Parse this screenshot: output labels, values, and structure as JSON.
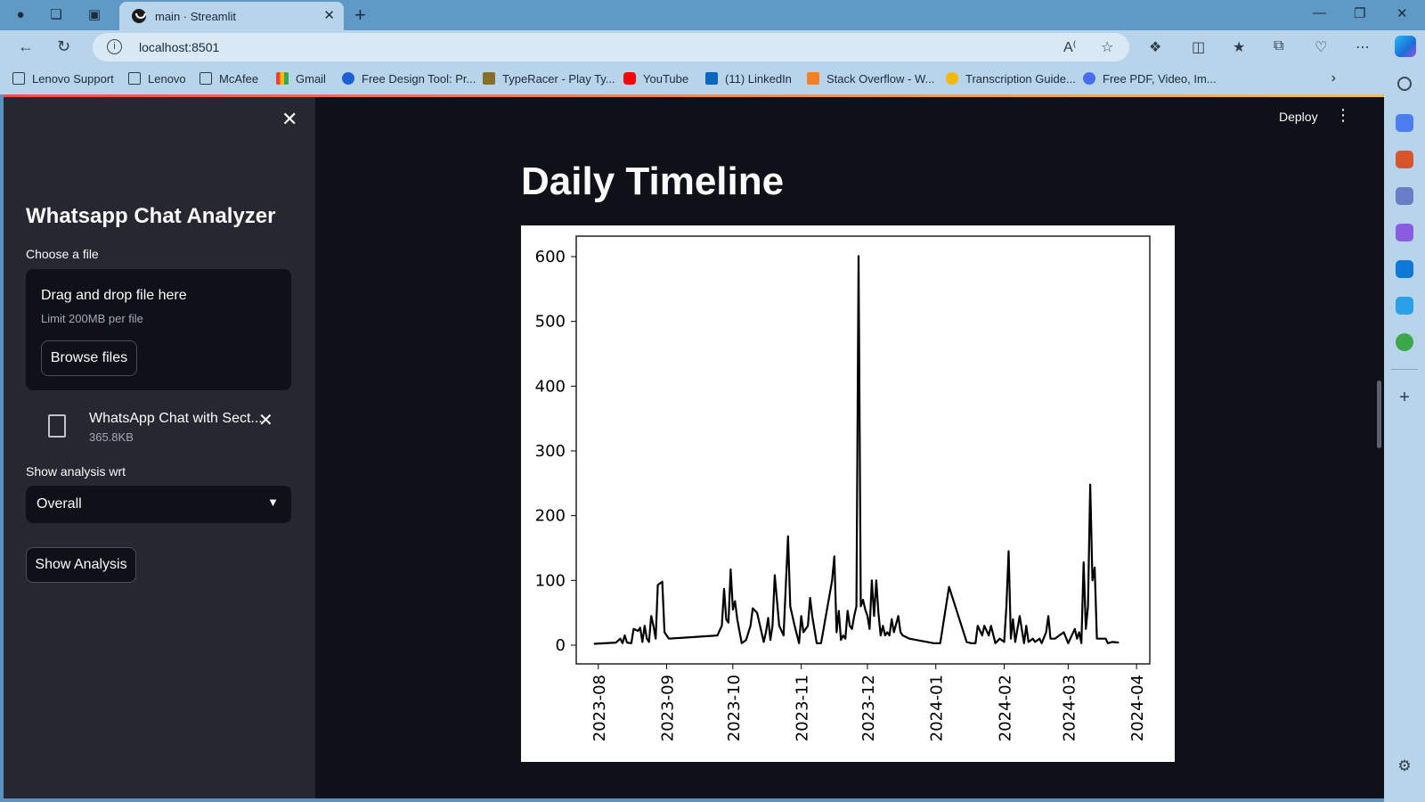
{
  "browser": {
    "tab_title": "main · Streamlit",
    "url": "localhost:8501",
    "bookmarks": [
      {
        "label": "Lenovo Support",
        "icon": "doc"
      },
      {
        "label": "Lenovo",
        "icon": "doc"
      },
      {
        "label": "McAfee",
        "icon": "doc"
      },
      {
        "label": "Gmail",
        "icon": "gmail"
      },
      {
        "label": "Free Design Tool: Pr...",
        "icon": "canva"
      },
      {
        "label": "TypeRacer - Play Ty...",
        "icon": "typer"
      },
      {
        "label": "YouTube",
        "icon": "yt"
      },
      {
        "label": "(11) LinkedIn",
        "icon": "li"
      },
      {
        "label": "Stack Overflow - W...",
        "icon": "so"
      },
      {
        "label": "Transcription Guide...",
        "icon": "tr"
      },
      {
        "label": "Free PDF, Video, Im...",
        "icon": "pdf"
      }
    ]
  },
  "sidebar": {
    "title": "Whatsapp Chat Analyzer",
    "uploader_label": "Choose a file",
    "dropzone_main": "Drag and drop file here",
    "dropzone_sub": "Limit 200MB per file",
    "browse_label": "Browse files",
    "file_name": "WhatsApp Chat with Sect...",
    "file_size": "365.8KB",
    "select_label": "Show analysis wrt",
    "select_value": "Overall",
    "analysis_button": "Show Analysis"
  },
  "header": {
    "deploy_label": "Deploy"
  },
  "main": {
    "title": "Daily Timeline"
  },
  "colors": {
    "app_bg": "#0e1117",
    "sidebar_bg": "#262730",
    "text": "#fafafa",
    "browser_chrome": "#b8d4ea",
    "titlebar": "#5f9ac6",
    "line": "#000000"
  },
  "chart_data": {
    "type": "line",
    "title": "",
    "xlabel": "",
    "ylabel": "",
    "ylim": [
      0,
      600
    ],
    "yticks": [
      0,
      100,
      200,
      300,
      400,
      500,
      600
    ],
    "xticks": [
      "2023-08",
      "2023-09",
      "2023-10",
      "2023-11",
      "2023-12",
      "2024-01",
      "2024-02",
      "2024-03",
      "2024-04"
    ],
    "grid": false,
    "series": [
      {
        "values": [
          [
            "2023-07-30",
            2
          ],
          [
            "2023-08-09",
            4
          ],
          [
            "2023-08-11",
            10
          ],
          [
            "2023-08-12",
            3
          ],
          [
            "2023-08-13",
            15
          ],
          [
            "2023-08-14",
            4
          ],
          [
            "2023-08-16",
            3
          ],
          [
            "2023-08-17",
            25
          ],
          [
            "2023-08-19",
            22
          ],
          [
            "2023-08-20",
            27
          ],
          [
            "2023-08-21",
            5
          ],
          [
            "2023-08-22",
            30
          ],
          [
            "2023-08-23",
            10
          ],
          [
            "2023-08-24",
            5
          ],
          [
            "2023-08-25",
            45
          ],
          [
            "2023-08-26",
            30
          ],
          [
            "2023-08-27",
            10
          ],
          [
            "2023-08-28",
            93
          ],
          [
            "2023-08-30",
            98
          ],
          [
            "2023-08-31",
            20
          ],
          [
            "2023-09-02",
            10
          ],
          [
            "2023-09-24",
            15
          ],
          [
            "2023-09-26",
            30
          ],
          [
            "2023-09-27",
            87
          ],
          [
            "2023-09-28",
            40
          ],
          [
            "2023-09-29",
            35
          ],
          [
            "2023-09-30",
            117
          ],
          [
            "2023-10-01",
            55
          ],
          [
            "2023-10-02",
            68
          ],
          [
            "2023-10-03",
            40
          ],
          [
            "2023-10-05",
            3
          ],
          [
            "2023-10-07",
            8
          ],
          [
            "2023-10-09",
            30
          ],
          [
            "2023-10-10",
            57
          ],
          [
            "2023-10-12",
            50
          ],
          [
            "2023-10-15",
            5
          ],
          [
            "2023-10-16",
            20
          ],
          [
            "2023-10-17",
            42
          ],
          [
            "2023-10-18",
            8
          ],
          [
            "2023-10-19",
            30
          ],
          [
            "2023-10-20",
            108
          ],
          [
            "2023-10-22",
            30
          ],
          [
            "2023-10-24",
            15
          ],
          [
            "2023-10-26",
            168
          ],
          [
            "2023-10-27",
            60
          ],
          [
            "2023-10-29",
            30
          ],
          [
            "2023-10-31",
            3
          ],
          [
            "2023-11-01",
            45
          ],
          [
            "2023-11-02",
            20
          ],
          [
            "2023-11-04",
            30
          ],
          [
            "2023-11-05",
            73
          ],
          [
            "2023-11-06",
            45
          ],
          [
            "2023-11-08",
            3
          ],
          [
            "2023-11-10",
            3
          ],
          [
            "2023-11-15",
            100
          ],
          [
            "2023-11-16",
            137
          ],
          [
            "2023-11-17",
            20
          ],
          [
            "2023-11-18",
            53
          ],
          [
            "2023-11-19",
            8
          ],
          [
            "2023-11-20",
            15
          ],
          [
            "2023-11-21",
            10
          ],
          [
            "2023-11-22",
            53
          ],
          [
            "2023-11-23",
            30
          ],
          [
            "2023-11-24",
            25
          ],
          [
            "2023-11-25",
            45
          ],
          [
            "2023-11-26",
            60
          ],
          [
            "2023-11-27",
            601
          ],
          [
            "2023-11-28",
            60
          ],
          [
            "2023-11-29",
            70
          ],
          [
            "2023-11-30",
            55
          ],
          [
            "2023-12-01",
            45
          ],
          [
            "2023-12-02",
            25
          ],
          [
            "2023-12-03",
            100
          ],
          [
            "2023-12-04",
            45
          ],
          [
            "2023-12-05",
            100
          ],
          [
            "2023-12-06",
            50
          ],
          [
            "2023-12-07",
            15
          ],
          [
            "2023-12-08",
            30
          ],
          [
            "2023-12-09",
            15
          ],
          [
            "2023-12-10",
            20
          ],
          [
            "2023-12-11",
            15
          ],
          [
            "2023-12-12",
            40
          ],
          [
            "2023-12-13",
            20
          ],
          [
            "2023-12-15",
            45
          ],
          [
            "2023-12-16",
            20
          ],
          [
            "2023-12-17",
            15
          ],
          [
            "2023-12-20",
            10
          ],
          [
            "2023-12-31",
            3
          ],
          [
            "2024-01-03",
            3
          ],
          [
            "2024-01-07",
            90
          ],
          [
            "2024-01-15",
            5
          ],
          [
            "2024-01-17",
            3
          ],
          [
            "2024-01-19",
            3
          ],
          [
            "2024-01-20",
            30
          ],
          [
            "2024-01-22",
            15
          ],
          [
            "2024-01-23",
            30
          ],
          [
            "2024-01-25",
            15
          ],
          [
            "2024-01-26",
            30
          ],
          [
            "2024-01-28",
            3
          ],
          [
            "2024-01-30",
            10
          ],
          [
            "2024-02-01",
            5
          ],
          [
            "2024-02-02",
            60
          ],
          [
            "2024-02-03",
            145
          ],
          [
            "2024-02-04",
            10
          ],
          [
            "2024-02-05",
            40
          ],
          [
            "2024-02-06",
            5
          ],
          [
            "2024-02-08",
            45
          ],
          [
            "2024-02-10",
            3
          ],
          [
            "2024-02-11",
            30
          ],
          [
            "2024-02-12",
            5
          ],
          [
            "2024-02-14",
            10
          ],
          [
            "2024-02-15",
            5
          ],
          [
            "2024-02-17",
            10
          ],
          [
            "2024-02-18",
            3
          ],
          [
            "2024-02-20",
            20
          ],
          [
            "2024-02-21",
            45
          ],
          [
            "2024-02-22",
            10
          ],
          [
            "2024-02-24",
            10
          ],
          [
            "2024-02-26",
            15
          ],
          [
            "2024-02-28",
            20
          ],
          [
            "2024-03-01",
            3
          ],
          [
            "2024-03-04",
            25
          ],
          [
            "2024-03-05",
            10
          ],
          [
            "2024-03-06",
            20
          ],
          [
            "2024-03-07",
            3
          ],
          [
            "2024-03-08",
            128
          ],
          [
            "2024-03-09",
            25
          ],
          [
            "2024-03-10",
            60
          ],
          [
            "2024-03-11",
            248
          ],
          [
            "2024-03-12",
            100
          ],
          [
            "2024-03-13",
            120
          ],
          [
            "2024-03-14",
            10
          ],
          [
            "2024-03-18",
            10
          ],
          [
            "2024-03-19",
            3
          ],
          [
            "2024-03-21",
            5
          ],
          [
            "2024-03-24",
            4
          ]
        ]
      }
    ],
    "x_range": [
      "2023-07-22",
      "2024-04-07"
    ]
  }
}
